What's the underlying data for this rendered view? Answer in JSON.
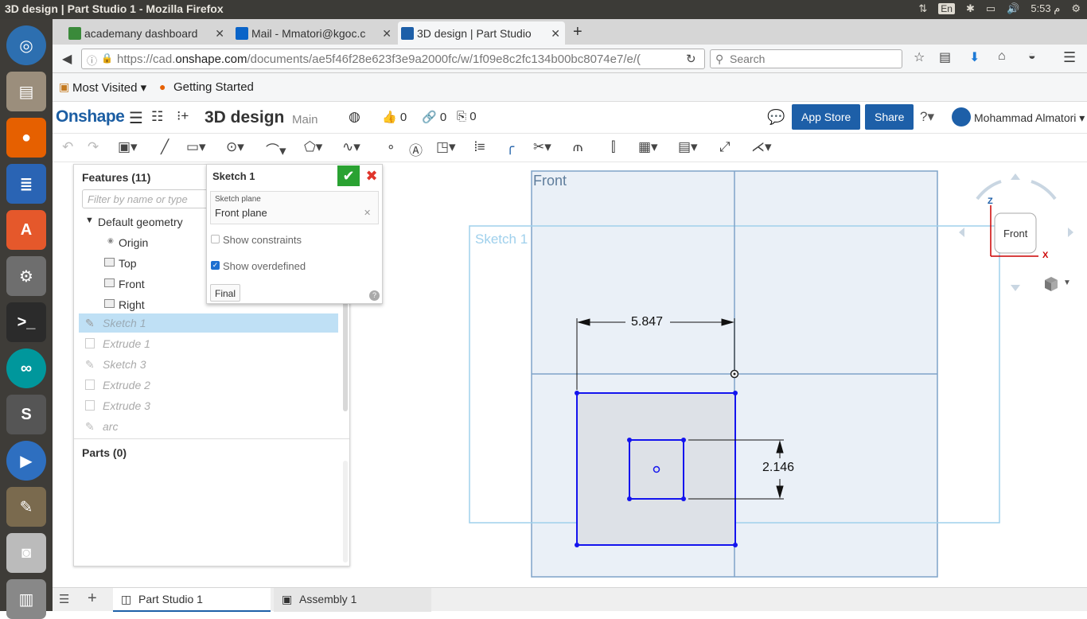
{
  "os": {
    "window_title": "3D design | Part Studio 1 - Mozilla Firefox",
    "lang": "En",
    "time": "5:53",
    "ampm": "م"
  },
  "tabs": [
    {
      "label": "academany dashboard",
      "active": false
    },
    {
      "label": "Mail - Mmatori@kgoc.c",
      "active": false
    },
    {
      "label": "3D design | Part Studio",
      "active": true
    }
  ],
  "nav": {
    "url_prefix": "https://cad.",
    "url_domain": "onshape.com",
    "url_rest": "/documents/ae5f46f28e623f3e9a2000fc/w/1f09e8c2fc134b00bc8074e7/e/(",
    "search_placeholder": "Search"
  },
  "bookmarks": {
    "most_visited": "Most Visited",
    "getting_started": "Getting Started"
  },
  "onshape": {
    "logo": "Onshape",
    "doc_title": "3D design",
    "branch": "Main",
    "likes": "0",
    "links": "0",
    "copies": "0",
    "app_store": "App Store",
    "share": "Share",
    "user": "Mohammad Almatori"
  },
  "features": {
    "header": "Features (11)",
    "filter_placeholder": "Filter by name or type",
    "default_geometry": "Default geometry",
    "items": [
      "Origin",
      "Top",
      "Front",
      "Right"
    ],
    "sketches": [
      "Sketch 1",
      "Extrude 1",
      "Sketch 3",
      "Extrude 2",
      "Extrude 3",
      "arc"
    ],
    "parts": "Parts (0)"
  },
  "sketch_panel": {
    "title": "Sketch 1",
    "plane_label": "Sketch plane",
    "plane_value": "Front plane",
    "show_constraints": "Show constraints",
    "show_overdefined": "Show overdefined",
    "final": "Final"
  },
  "viewport": {
    "plane_label": "Front",
    "sketch_label": "Sketch 1",
    "dim_horizontal": "5.847",
    "dim_vertical": "2.146",
    "view_cube": "Front",
    "axis_z": "Z",
    "axis_x": "X"
  },
  "bottom_tabs": [
    "Part Studio 1",
    "Assembly 1"
  ]
}
